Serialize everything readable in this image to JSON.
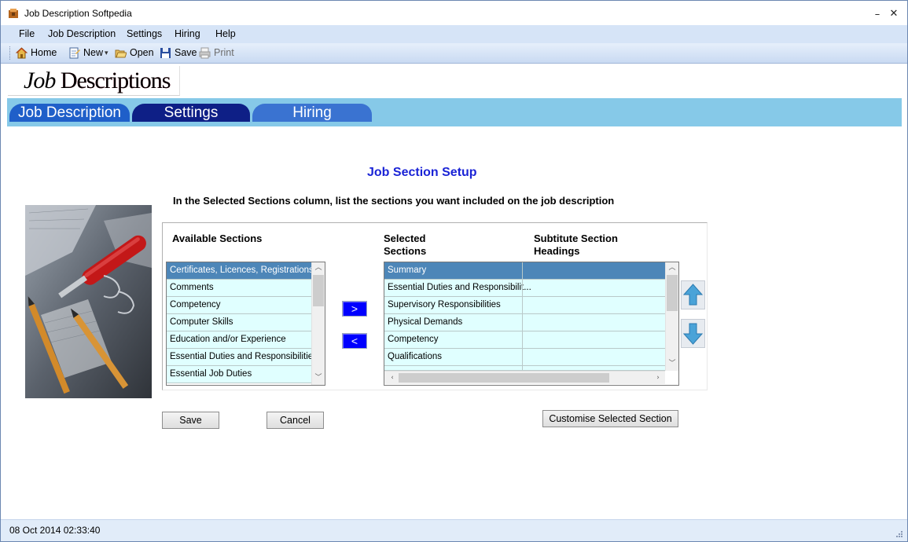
{
  "window": {
    "title": "Job Description Softpedia",
    "minimize_glyph": "–",
    "close_glyph": "✕"
  },
  "menu": [
    {
      "label": "File"
    },
    {
      "label": "Job Description"
    },
    {
      "label": "Settings"
    },
    {
      "label": "Hiring"
    },
    {
      "label": "Help"
    }
  ],
  "toolbar": {
    "home": {
      "label": "Home",
      "icon": "home-icon"
    },
    "new": {
      "label": "New",
      "icon": "new-document-icon",
      "dropdown_glyph": "▾"
    },
    "open": {
      "label": "Open",
      "icon": "open-folder-icon"
    },
    "save": {
      "label": "Save",
      "icon": "floppy-disk-icon"
    },
    "print": {
      "label": "Print",
      "icon": "printer-icon",
      "enabled": false
    }
  },
  "logo": {
    "part1": "Job ",
    "part2": "Descriptions"
  },
  "tabs": [
    {
      "label": "Job Description"
    },
    {
      "label": "Settings",
      "selected": true
    },
    {
      "label": "Hiring"
    }
  ],
  "main": {
    "heading": "Job Section Setup",
    "instructions": "In the Selected Sections column, list the sections you want included on the job description",
    "available_header": "Available Sections",
    "selected_header_line1": "Selected",
    "selected_header_line2": "Sections",
    "substitute_header_line1": "Subtitute Section",
    "substitute_header_line2": "Headings",
    "available_sections": [
      "Certificates, Licences, Registrations",
      "Comments",
      "Competency",
      "Computer Skills",
      "Education and/or Experience",
      "Essential Duties and Responsibilities",
      "Essential Job Duties"
    ],
    "selected_sections": [
      "Summary",
      "Essential Duties and Responsibilit...",
      "Supervisory Responsibilities",
      "Physical Demands",
      "Competency",
      "Qualifications"
    ],
    "add_button_label": ">",
    "remove_button_label": "<",
    "save_label": "Save",
    "cancel_label": "Cancel",
    "customise_label": "Customise Selected Section",
    "colors": {
      "selected_row": "#4d86b8",
      "row_background": "#e0ffff",
      "heading": "#1a23d6"
    }
  },
  "status": {
    "datetime": "08 Oct 2014 02:33:40"
  }
}
